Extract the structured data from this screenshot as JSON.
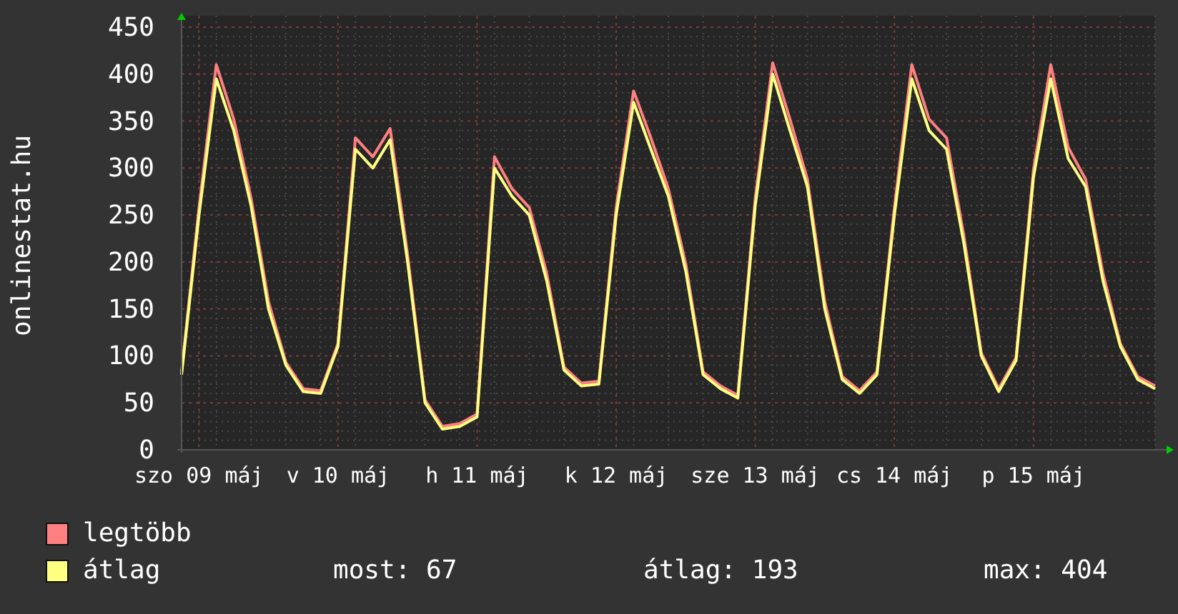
{
  "chart_data": {
    "type": "line",
    "grid": true,
    "ylabel": "onlinestat.hu",
    "categories": [
      null,
      "szo 09 máj",
      null,
      null,
      null,
      null,
      null,
      null,
      null,
      "v 10 máj",
      null,
      null,
      null,
      null,
      null,
      null,
      null,
      "h 11 máj",
      null,
      null,
      null,
      null,
      null,
      null,
      null,
      "k 12 máj",
      null,
      null,
      null,
      null,
      null,
      null,
      null,
      "sze 13 máj",
      null,
      null,
      null,
      null,
      null,
      null,
      null,
      "cs 14 máj",
      null,
      null,
      null,
      null,
      null,
      null,
      null,
      "p 15 máj",
      null,
      null,
      null,
      null,
      null,
      null,
      null
    ],
    "ylim": [
      0,
      450
    ],
    "yticks": [
      0,
      50,
      100,
      150,
      200,
      250,
      300,
      350,
      400,
      450
    ],
    "series": [
      {
        "name": "legtöbb",
        "color": "#ff8080",
        "values": [
          83,
          258,
          410,
          352,
          268,
          158,
          93,
          65,
          63,
          113,
          332,
          312,
          342,
          208,
          53,
          25,
          28,
          38,
          312,
          278,
          258,
          188,
          88,
          71,
          73,
          258,
          382,
          332,
          278,
          198,
          83,
          68,
          58,
          268,
          412,
          352,
          288,
          158,
          78,
          63,
          83,
          258,
          410,
          352,
          332,
          228,
          103,
          65,
          98,
          298,
          410,
          322,
          288,
          188,
          113,
          78,
          68
        ]
      },
      {
        "name": "átlag",
        "color": "#ffff80",
        "values": [
          80,
          250,
          395,
          340,
          260,
          150,
          90,
          62,
          60,
          110,
          320,
          300,
          330,
          200,
          50,
          22,
          25,
          35,
          300,
          270,
          250,
          180,
          85,
          68,
          70,
          250,
          370,
          320,
          270,
          190,
          80,
          65,
          55,
          260,
          400,
          340,
          280,
          150,
          75,
          60,
          80,
          250,
          395,
          340,
          320,
          220,
          100,
          62,
          95,
          290,
          395,
          310,
          280,
          180,
          110,
          75,
          65
        ]
      }
    ]
  },
  "stats": [
    "most: 67",
    "átlag: 193",
    "max: 404"
  ]
}
